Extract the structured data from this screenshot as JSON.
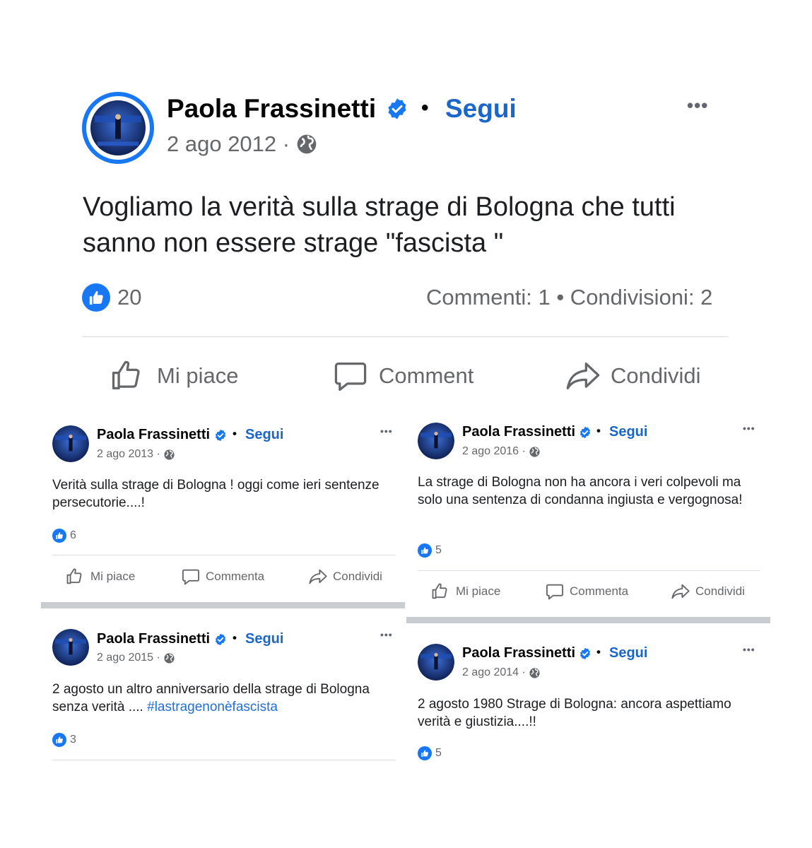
{
  "colors": {
    "accent": "#1877f2",
    "follow": "#1b66c9",
    "muted": "#65676b",
    "divider": "#dadde1"
  },
  "icons": [
    "avatar-photo",
    "verified-badge-icon",
    "globe-icon",
    "more-options-icon",
    "like-reaction-icon",
    "thumbs-up-icon",
    "comment-icon",
    "share-icon"
  ],
  "author": {
    "name": "Paola Frassinetti",
    "follow": "Segui",
    "separator": "•",
    "more": "•••"
  },
  "main_post": {
    "date": "2 ago 2012 ·",
    "text": "Vogliamo la verità sulla strage di Bologna che tutti sanno non essere strage \"fascista \"",
    "likes": "20",
    "stats": "Commenti: 1 • Condivisioni: 2",
    "actions": {
      "like": "Mi piace",
      "comment": "Comment",
      "share": "Condividi"
    }
  },
  "posts": [
    {
      "date": "2 ago 2013 ·",
      "text": "Verità sulla strage di Bologna ! oggi come ieri sentenze persecutorie....!",
      "likes": "6",
      "actions": {
        "like": "Mi piace",
        "comment": "Commenta",
        "share": "Condividi"
      }
    },
    {
      "date": "2 ago 2016 ·",
      "text": "La strage di Bologna non ha ancora i veri colpevoli ma solo una sentenza di condanna ingiusta e vergognosa!",
      "likes": "5",
      "actions": {
        "like": "Mi piace",
        "comment": "Commenta",
        "share": "Condividi"
      }
    },
    {
      "date": "2 ago 2015 ·",
      "text": "2 agosto un altro anniversario della strage di Bologna senza verità .... ",
      "hashtag": "#lastragenonèfascista",
      "likes": "3"
    },
    {
      "date": "2 ago 2014 ·",
      "text": "2 agosto 1980 Strage di Bologna: ancora aspettiamo verità e giustizia....!!",
      "likes": "5"
    }
  ]
}
